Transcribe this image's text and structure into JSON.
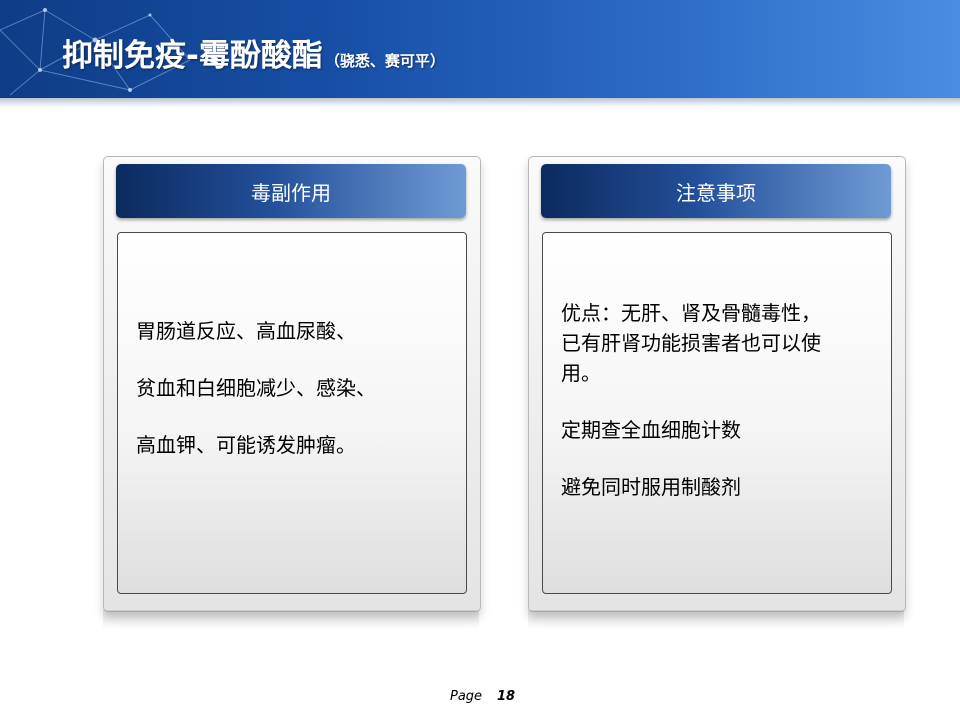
{
  "slide": {
    "title": "抑制免疫-霉酚酸酯",
    "subtitle": "（骁悉、赛可平）"
  },
  "left_panel": {
    "header": "毒副作用",
    "lines": [
      "胃肠道反应、高血尿酸、",
      "贫血和白细胞减少、感染、",
      "高血钾、可能诱发肿瘤。"
    ]
  },
  "right_panel": {
    "header": "注意事项",
    "lines": [
      "优点：无肝、肾及骨髓毒性，",
      "已有肝肾功能损害者也可以使",
      "用。",
      "定期查全血细胞计数",
      "避免同时服用制酸剂"
    ]
  },
  "footer": {
    "page_label": "Page",
    "page_number": "18"
  }
}
